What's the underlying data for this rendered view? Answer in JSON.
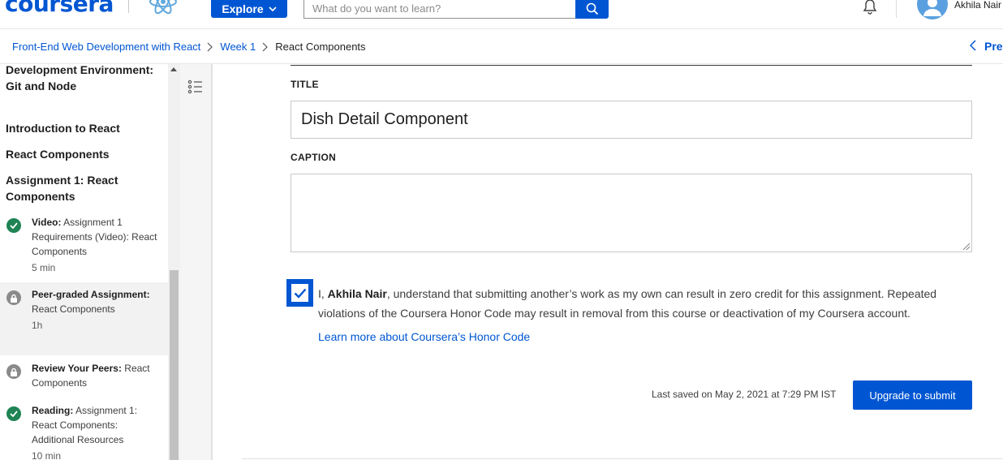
{
  "header": {
    "logo": "coursera",
    "explore_label": "Explore",
    "search_placeholder": "What do you want to learn?",
    "user_name": "Akhila Nair"
  },
  "breadcrumb": {
    "items": [
      "Front-End Web Development with React",
      "Week 1"
    ],
    "current": "React Components",
    "prev_label": "Pre"
  },
  "sidebar": {
    "headings": [
      "Development Environment: Git and Node",
      "Introduction to React",
      "React Components",
      "Assignment 1: React Components"
    ],
    "items": [
      {
        "type": "Video:",
        "title": "Assignment 1 Requirements (Video): React Components",
        "duration": "5 min",
        "status": "done"
      },
      {
        "type": "Peer-graded Assignment:",
        "title": "React Components",
        "duration": "1h",
        "status": "locked"
      },
      {
        "type": "Review Your Peers:",
        "title": "React Components",
        "duration": "",
        "status": "locked"
      },
      {
        "type": "Reading:",
        "title": "Assignment 1: React Components: Additional Resources",
        "duration": "10 min",
        "status": "done"
      }
    ]
  },
  "form": {
    "title_label": "TITLE",
    "title_value": "Dish Detail Component",
    "caption_label": "CAPTION",
    "caption_value": "",
    "honor_prefix": "I,",
    "honor_name": "Akhila Nair",
    "honor_text": ", understand that submitting another’s work as my own can result in zero credit for this assignment. Repeated violations of the Coursera Honor Code may result in removal from this course or deactivation of my Coursera account.",
    "honor_checked": true,
    "honor_link": "Learn more about Coursera’s Honor Code",
    "last_saved": "Last saved on May 2, 2021 at 7:29 PM IST",
    "submit_label": "Upgrade to submit"
  },
  "colors": {
    "brand": "#0056d2",
    "done": "#1f8354",
    "locked": "#8a8a8a"
  },
  "icons": [
    "coursera-logo",
    "react-logo",
    "chevron-down-icon",
    "search-icon",
    "bell-icon",
    "avatar-icon",
    "chevron-right-icon",
    "chevron-left-icon",
    "table-of-contents-icon",
    "check-circle-icon",
    "lock-icon",
    "checkbox-checked-icon"
  ]
}
